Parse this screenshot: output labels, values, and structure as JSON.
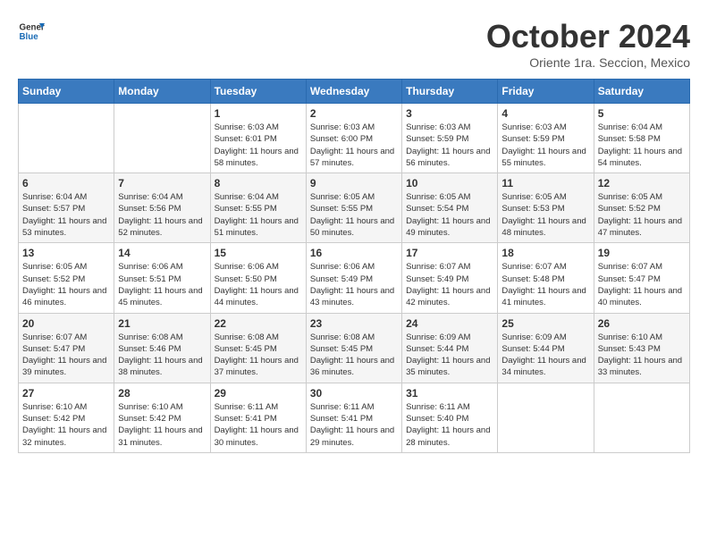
{
  "logo": {
    "text_general": "General",
    "text_blue": "Blue"
  },
  "header": {
    "month": "October 2024",
    "location": "Oriente 1ra. Seccion, Mexico"
  },
  "weekdays": [
    "Sunday",
    "Monday",
    "Tuesday",
    "Wednesday",
    "Thursday",
    "Friday",
    "Saturday"
  ],
  "weeks": [
    [
      {
        "day": "",
        "info": ""
      },
      {
        "day": "",
        "info": ""
      },
      {
        "day": "1",
        "info": "Sunrise: 6:03 AM\nSunset: 6:01 PM\nDaylight: 11 hours and 58 minutes."
      },
      {
        "day": "2",
        "info": "Sunrise: 6:03 AM\nSunset: 6:00 PM\nDaylight: 11 hours and 57 minutes."
      },
      {
        "day": "3",
        "info": "Sunrise: 6:03 AM\nSunset: 5:59 PM\nDaylight: 11 hours and 56 minutes."
      },
      {
        "day": "4",
        "info": "Sunrise: 6:03 AM\nSunset: 5:59 PM\nDaylight: 11 hours and 55 minutes."
      },
      {
        "day": "5",
        "info": "Sunrise: 6:04 AM\nSunset: 5:58 PM\nDaylight: 11 hours and 54 minutes."
      }
    ],
    [
      {
        "day": "6",
        "info": "Sunrise: 6:04 AM\nSunset: 5:57 PM\nDaylight: 11 hours and 53 minutes."
      },
      {
        "day": "7",
        "info": "Sunrise: 6:04 AM\nSunset: 5:56 PM\nDaylight: 11 hours and 52 minutes."
      },
      {
        "day": "8",
        "info": "Sunrise: 6:04 AM\nSunset: 5:55 PM\nDaylight: 11 hours and 51 minutes."
      },
      {
        "day": "9",
        "info": "Sunrise: 6:05 AM\nSunset: 5:55 PM\nDaylight: 11 hours and 50 minutes."
      },
      {
        "day": "10",
        "info": "Sunrise: 6:05 AM\nSunset: 5:54 PM\nDaylight: 11 hours and 49 minutes."
      },
      {
        "day": "11",
        "info": "Sunrise: 6:05 AM\nSunset: 5:53 PM\nDaylight: 11 hours and 48 minutes."
      },
      {
        "day": "12",
        "info": "Sunrise: 6:05 AM\nSunset: 5:52 PM\nDaylight: 11 hours and 47 minutes."
      }
    ],
    [
      {
        "day": "13",
        "info": "Sunrise: 6:05 AM\nSunset: 5:52 PM\nDaylight: 11 hours and 46 minutes."
      },
      {
        "day": "14",
        "info": "Sunrise: 6:06 AM\nSunset: 5:51 PM\nDaylight: 11 hours and 45 minutes."
      },
      {
        "day": "15",
        "info": "Sunrise: 6:06 AM\nSunset: 5:50 PM\nDaylight: 11 hours and 44 minutes."
      },
      {
        "day": "16",
        "info": "Sunrise: 6:06 AM\nSunset: 5:49 PM\nDaylight: 11 hours and 43 minutes."
      },
      {
        "day": "17",
        "info": "Sunrise: 6:07 AM\nSunset: 5:49 PM\nDaylight: 11 hours and 42 minutes."
      },
      {
        "day": "18",
        "info": "Sunrise: 6:07 AM\nSunset: 5:48 PM\nDaylight: 11 hours and 41 minutes."
      },
      {
        "day": "19",
        "info": "Sunrise: 6:07 AM\nSunset: 5:47 PM\nDaylight: 11 hours and 40 minutes."
      }
    ],
    [
      {
        "day": "20",
        "info": "Sunrise: 6:07 AM\nSunset: 5:47 PM\nDaylight: 11 hours and 39 minutes."
      },
      {
        "day": "21",
        "info": "Sunrise: 6:08 AM\nSunset: 5:46 PM\nDaylight: 11 hours and 38 minutes."
      },
      {
        "day": "22",
        "info": "Sunrise: 6:08 AM\nSunset: 5:45 PM\nDaylight: 11 hours and 37 minutes."
      },
      {
        "day": "23",
        "info": "Sunrise: 6:08 AM\nSunset: 5:45 PM\nDaylight: 11 hours and 36 minutes."
      },
      {
        "day": "24",
        "info": "Sunrise: 6:09 AM\nSunset: 5:44 PM\nDaylight: 11 hours and 35 minutes."
      },
      {
        "day": "25",
        "info": "Sunrise: 6:09 AM\nSunset: 5:44 PM\nDaylight: 11 hours and 34 minutes."
      },
      {
        "day": "26",
        "info": "Sunrise: 6:10 AM\nSunset: 5:43 PM\nDaylight: 11 hours and 33 minutes."
      }
    ],
    [
      {
        "day": "27",
        "info": "Sunrise: 6:10 AM\nSunset: 5:42 PM\nDaylight: 11 hours and 32 minutes."
      },
      {
        "day": "28",
        "info": "Sunrise: 6:10 AM\nSunset: 5:42 PM\nDaylight: 11 hours and 31 minutes."
      },
      {
        "day": "29",
        "info": "Sunrise: 6:11 AM\nSunset: 5:41 PM\nDaylight: 11 hours and 30 minutes."
      },
      {
        "day": "30",
        "info": "Sunrise: 6:11 AM\nSunset: 5:41 PM\nDaylight: 11 hours and 29 minutes."
      },
      {
        "day": "31",
        "info": "Sunrise: 6:11 AM\nSunset: 5:40 PM\nDaylight: 11 hours and 28 minutes."
      },
      {
        "day": "",
        "info": ""
      },
      {
        "day": "",
        "info": ""
      }
    ]
  ]
}
